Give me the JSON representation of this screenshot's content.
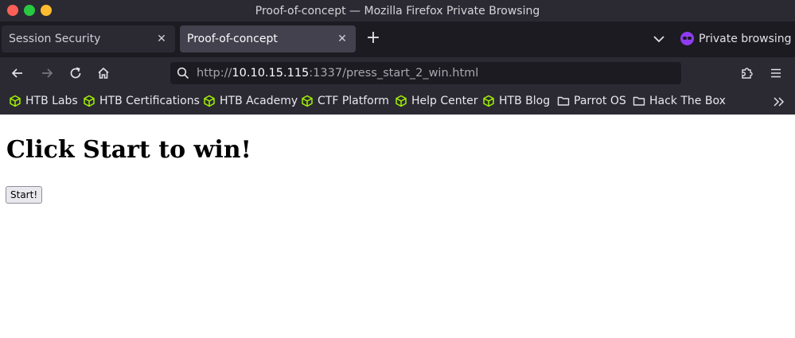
{
  "window": {
    "title": "Proof-of-concept — Mozilla Firefox Private Browsing"
  },
  "tabs": [
    {
      "label": "Session Security",
      "active": false
    },
    {
      "label": "Proof-of-concept",
      "active": true
    }
  ],
  "private_label": "Private browsing",
  "url": {
    "scheme": "http://",
    "host": "10.10.15.115",
    "rest": ":1337/press_start_2_win.html"
  },
  "bookmarks": [
    {
      "label": "HTB Labs",
      "icon": "cube-icon"
    },
    {
      "label": "HTB Certifications",
      "icon": "cube-icon"
    },
    {
      "label": "HTB Academy",
      "icon": "cube-icon"
    },
    {
      "label": "CTF Platform",
      "icon": "cube-icon"
    },
    {
      "label": "Help Center",
      "icon": "cube-icon"
    },
    {
      "label": "HTB Blog",
      "icon": "cube-icon"
    },
    {
      "label": "Parrot OS",
      "icon": "folder-icon"
    },
    {
      "label": "Hack The Box",
      "icon": "folder-icon"
    }
  ],
  "page": {
    "heading": "Click Start to win!",
    "button_label": "Start!"
  },
  "colors": {
    "accent_green": "#9fef00",
    "private_purple": "#8f3cf0"
  }
}
